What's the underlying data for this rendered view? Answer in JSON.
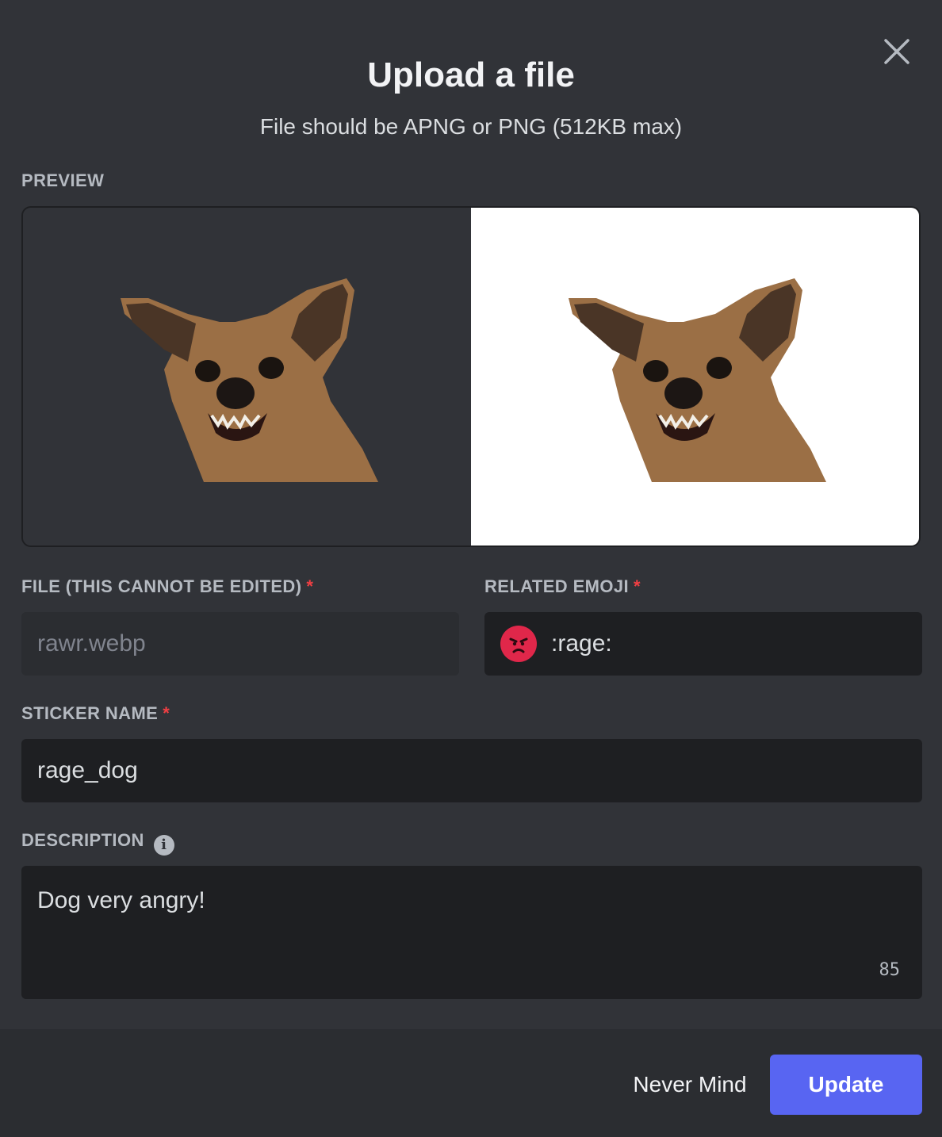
{
  "modal": {
    "title": "Upload a file",
    "subtitle": "File should be APNG or PNG (512KB max)"
  },
  "preview": {
    "label": "PREVIEW"
  },
  "file": {
    "label": "FILE (THIS CANNOT BE EDITED)",
    "required_marker": "*",
    "value": "rawr.webp"
  },
  "related_emoji": {
    "label": "RELATED EMOJI",
    "required_marker": "*",
    "icon": "rage-emoji-icon",
    "value": ":rage:"
  },
  "sticker_name": {
    "label": "STICKER NAME",
    "required_marker": "*",
    "value": "rage_dog"
  },
  "description": {
    "label": "DESCRIPTION",
    "info_icon": "info-icon",
    "value": "Dog very angry!",
    "chars_remaining": "85"
  },
  "footer": {
    "cancel_label": "Never Mind",
    "submit_label": "Update"
  },
  "colors": {
    "background": "#313338",
    "input": "#1e1f22",
    "footer": "#2b2d31",
    "accent": "#5865f2",
    "required": "#f23f43",
    "rage": "#e0274a"
  }
}
